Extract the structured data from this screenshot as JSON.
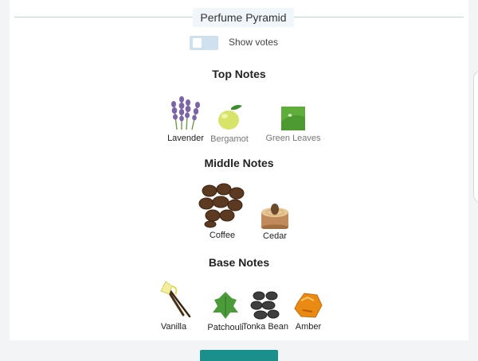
{
  "header": {
    "title": "Perfume Pyramid"
  },
  "toggle": {
    "label": "Show votes",
    "on": false
  },
  "tiers": [
    {
      "title": "Top Notes",
      "notes": [
        {
          "label": "Lavender",
          "icon": "lavender-icon",
          "selected": true
        },
        {
          "label": "Bergamot",
          "icon": "bergamot-icon",
          "selected": false
        },
        {
          "label": "Green Leaves",
          "icon": "green-leaves-icon",
          "selected": false
        }
      ]
    },
    {
      "title": "Middle Notes",
      "notes": [
        {
          "label": "Coffee",
          "icon": "coffee-icon",
          "selected": true
        },
        {
          "label": "Cedar",
          "icon": "cedar-icon",
          "selected": true
        }
      ]
    },
    {
      "title": "Base Notes",
      "notes": [
        {
          "label": "Vanilla",
          "icon": "vanilla-icon",
          "selected": true
        },
        {
          "label": "Patchouli",
          "icon": "patchouli-icon",
          "selected": true
        },
        {
          "label": "Tonka Bean",
          "icon": "tonka-bean-icon",
          "selected": true
        },
        {
          "label": "Amber",
          "icon": "amber-icon",
          "selected": true
        }
      ]
    }
  ],
  "colors": {
    "accent": "#1a8f8c",
    "toggle_track": "#cfe0ee",
    "divider": "#b8dccd",
    "chip_bg": "#f0f6f9"
  }
}
